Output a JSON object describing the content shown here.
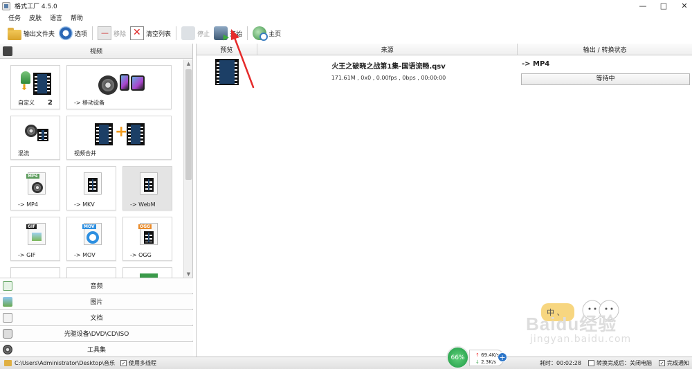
{
  "window": {
    "title": "格式工厂 4.5.0",
    "controls": [
      "—",
      "□",
      "✕"
    ]
  },
  "menu": [
    "任务",
    "皮肤",
    "语言",
    "帮助"
  ],
  "toolbar": {
    "output_folder": "输出文件夹",
    "options": "选项",
    "remove": "移除",
    "clear_list": "清空列表",
    "stop": "停止",
    "start": "开始",
    "home": "主页"
  },
  "sidebar": {
    "video_header": "视频",
    "tiles": {
      "custom": {
        "label": "自定义",
        "count": "2"
      },
      "mobile": {
        "label": "-> 移动设备"
      },
      "mix": {
        "label": "混流"
      },
      "merge": {
        "label": "视频合并"
      },
      "mp4": {
        "label": "-> MP4",
        "tag": "MP4"
      },
      "mkv": {
        "label": "-> MKV"
      },
      "webm": {
        "label": "-> WebM"
      },
      "gif": {
        "label": "-> GIF",
        "tag": "GIF"
      },
      "mov": {
        "label": "-> MOV",
        "tag": "MOV"
      },
      "ogg": {
        "label": "-> OGG",
        "tag": "OGG"
      }
    },
    "categories": [
      "音频",
      "图片",
      "文档",
      "光驱设备\\DVD\\CD\\ISO",
      "工具集"
    ]
  },
  "table": {
    "headers": [
      "预览",
      "来源",
      "输出 / 转换状态"
    ],
    "row": {
      "file_name": "火王之破晓之战第1集-国语流畅.qsv",
      "file_info": "171.61M , 0x0 , 0.00fps , 0bps , 00:00:00",
      "output_format": "-> MP4",
      "status": "等待中"
    }
  },
  "watermark": {
    "bubble": "中 、",
    "logo": "Baidu经验",
    "url": "jingyan.baidu.com"
  },
  "statusbar": {
    "path": "C:\\Users\\Administrator\\Desktop\\音乐",
    "multithread": "使用多线程",
    "elapsed": "耗时：00:02:28",
    "after_convert": "转换完成后：关闭电脑",
    "notify": "完成通知",
    "speed_percent": "66%",
    "upload": "69.4K/s",
    "download": "2.3K/s"
  }
}
